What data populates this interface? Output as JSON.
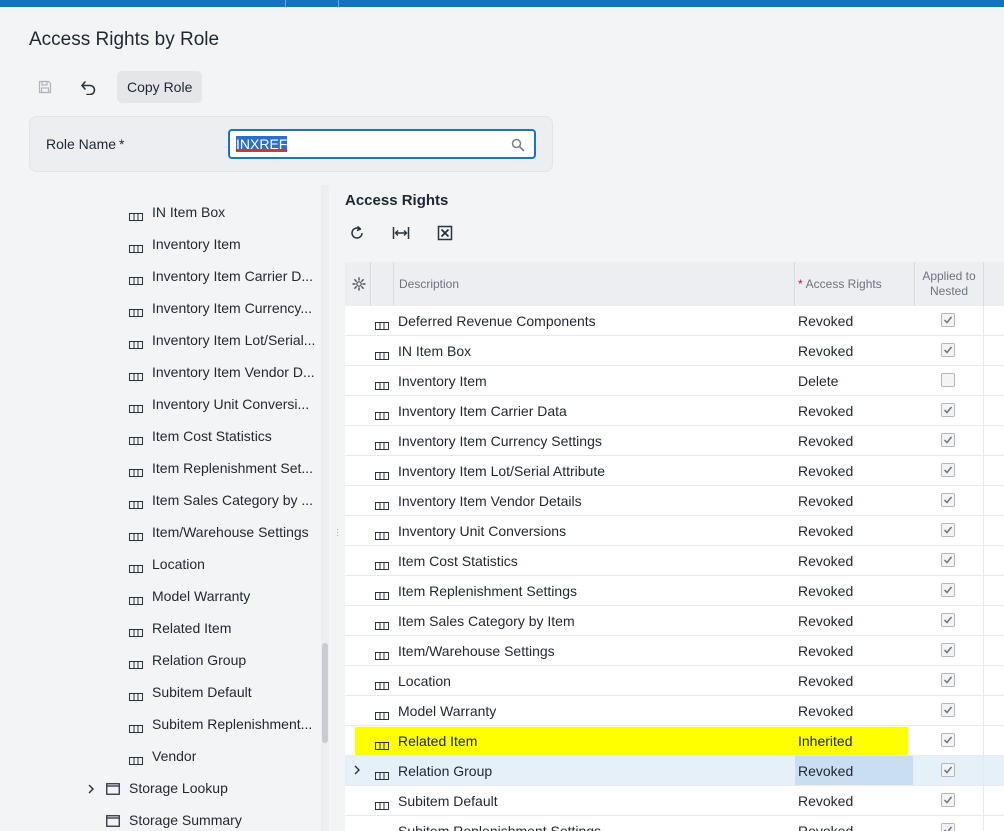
{
  "page": {
    "title": "Access Rights by Role"
  },
  "toolbar": {
    "copy_role_label": "Copy Role",
    "save_icon": "save-icon",
    "undo_icon": "undo-icon"
  },
  "role": {
    "label": "Role Name",
    "required_mark": "*",
    "value": "INXREF",
    "search_icon": "search-icon"
  },
  "tree": {
    "items": [
      {
        "label": "IN Item Box",
        "type": "leaf"
      },
      {
        "label": "Inventory Item",
        "type": "leaf"
      },
      {
        "label": "Inventory Item Carrier D...",
        "type": "leaf"
      },
      {
        "label": "Inventory Item Currency...",
        "type": "leaf"
      },
      {
        "label": "Inventory Item Lot/Serial...",
        "type": "leaf"
      },
      {
        "label": "Inventory Item Vendor D...",
        "type": "leaf"
      },
      {
        "label": "Inventory Unit Conversi...",
        "type": "leaf"
      },
      {
        "label": "Item Cost Statistics",
        "type": "leaf"
      },
      {
        "label": "Item Replenishment Set...",
        "type": "leaf"
      },
      {
        "label": "Item Sales Category by ...",
        "type": "leaf"
      },
      {
        "label": "Item/Warehouse Settings",
        "type": "leaf"
      },
      {
        "label": "Location",
        "type": "leaf"
      },
      {
        "label": "Model Warranty",
        "type": "leaf"
      },
      {
        "label": "Related Item",
        "type": "leaf"
      },
      {
        "label": "Relation Group",
        "type": "leaf"
      },
      {
        "label": "Subitem Default",
        "type": "leaf"
      },
      {
        "label": "Subitem Replenishment...",
        "type": "leaf"
      },
      {
        "label": "Vendor",
        "type": "leaf"
      },
      {
        "label": "Storage Lookup",
        "type": "screen",
        "expandable": true
      },
      {
        "label": "Storage Summary",
        "type": "screen",
        "expandable": false
      }
    ]
  },
  "access_rights": {
    "title": "Access Rights",
    "toolbar_icons": [
      "refresh-icon",
      "fit-columns-icon",
      "export-excel-icon"
    ],
    "columns": {
      "description": "Description",
      "access_rights_required": "*",
      "access_rights": "Access Rights",
      "applied_line1": "Applied to",
      "applied_line2": "Nested"
    },
    "rows": [
      {
        "description": "Deferred Revenue Components",
        "rights": "Revoked",
        "applied": true
      },
      {
        "description": "IN Item Box",
        "rights": "Revoked",
        "applied": true
      },
      {
        "description": "Inventory Item",
        "rights": "Delete",
        "applied": false
      },
      {
        "description": "Inventory Item Carrier Data",
        "rights": "Revoked",
        "applied": true
      },
      {
        "description": "Inventory Item Currency Settings",
        "rights": "Revoked",
        "applied": true
      },
      {
        "description": "Inventory Item Lot/Serial Attribute",
        "rights": "Revoked",
        "applied": true
      },
      {
        "description": "Inventory Item Vendor Details",
        "rights": "Revoked",
        "applied": true
      },
      {
        "description": "Inventory Unit Conversions",
        "rights": "Revoked",
        "applied": true
      },
      {
        "description": "Item Cost Statistics",
        "rights": "Revoked",
        "applied": true
      },
      {
        "description": "Item Replenishment Settings",
        "rights": "Revoked",
        "applied": true
      },
      {
        "description": "Item Sales Category by Item",
        "rights": "Revoked",
        "applied": true
      },
      {
        "description": "Item/Warehouse Settings",
        "rights": "Revoked",
        "applied": true
      },
      {
        "description": "Location",
        "rights": "Revoked",
        "applied": true
      },
      {
        "description": "Model Warranty",
        "rights": "Revoked",
        "applied": true
      },
      {
        "description": "Related Item",
        "rights": "Inherited",
        "applied": true,
        "highlighted": true
      },
      {
        "description": "Relation Group",
        "rights": "Revoked",
        "applied": true,
        "selected": true
      },
      {
        "description": "Subitem Default",
        "rights": "Revoked",
        "applied": true
      },
      {
        "description": "Subitem Replenishment Settings",
        "rights": "Revoked",
        "applied": true
      }
    ]
  },
  "colors": {
    "accent": "#0d74c8",
    "highlight": "#ffff00",
    "selected_row": "#e6f0f9",
    "selected_cell": "#c9def2",
    "required": "#c8102e"
  }
}
